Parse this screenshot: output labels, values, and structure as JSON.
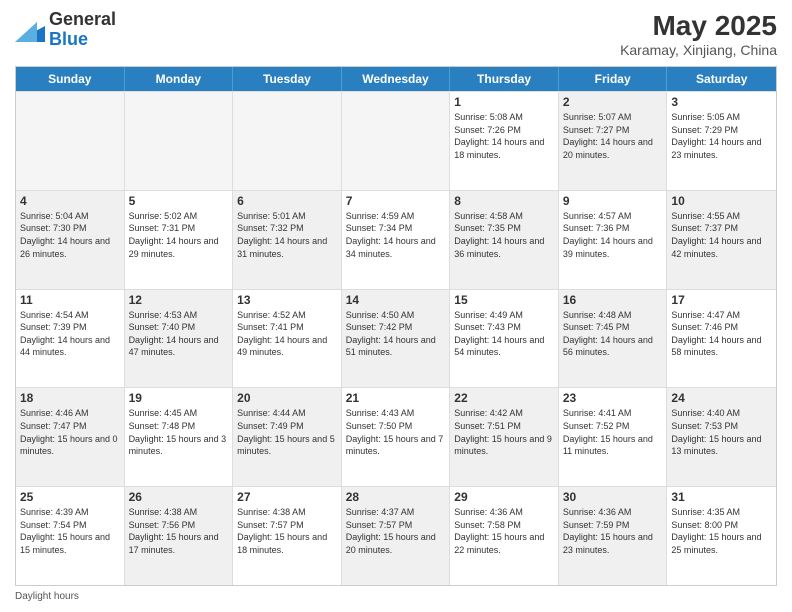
{
  "header": {
    "logo_general": "General",
    "logo_blue": "Blue",
    "main_title": "May 2025",
    "subtitle": "Karamay, Xinjiang, China"
  },
  "days_of_week": [
    "Sunday",
    "Monday",
    "Tuesday",
    "Wednesday",
    "Thursday",
    "Friday",
    "Saturday"
  ],
  "footer_text": "Daylight hours",
  "rows": [
    [
      {
        "day": "",
        "text": "",
        "empty": true
      },
      {
        "day": "",
        "text": "",
        "empty": true
      },
      {
        "day": "",
        "text": "",
        "empty": true
      },
      {
        "day": "",
        "text": "",
        "empty": true
      },
      {
        "day": "1",
        "text": "Sunrise: 5:08 AM\nSunset: 7:26 PM\nDaylight: 14 hours\nand 18 minutes.",
        "empty": false
      },
      {
        "day": "2",
        "text": "Sunrise: 5:07 AM\nSunset: 7:27 PM\nDaylight: 14 hours\nand 20 minutes.",
        "empty": false,
        "alt": true
      },
      {
        "day": "3",
        "text": "Sunrise: 5:05 AM\nSunset: 7:29 PM\nDaylight: 14 hours\nand 23 minutes.",
        "empty": false
      }
    ],
    [
      {
        "day": "4",
        "text": "Sunrise: 5:04 AM\nSunset: 7:30 PM\nDaylight: 14 hours\nand 26 minutes.",
        "empty": false,
        "alt": true
      },
      {
        "day": "5",
        "text": "Sunrise: 5:02 AM\nSunset: 7:31 PM\nDaylight: 14 hours\nand 29 minutes.",
        "empty": false
      },
      {
        "day": "6",
        "text": "Sunrise: 5:01 AM\nSunset: 7:32 PM\nDaylight: 14 hours\nand 31 minutes.",
        "empty": false,
        "alt": true
      },
      {
        "day": "7",
        "text": "Sunrise: 4:59 AM\nSunset: 7:34 PM\nDaylight: 14 hours\nand 34 minutes.",
        "empty": false
      },
      {
        "day": "8",
        "text": "Sunrise: 4:58 AM\nSunset: 7:35 PM\nDaylight: 14 hours\nand 36 minutes.",
        "empty": false,
        "alt": true
      },
      {
        "day": "9",
        "text": "Sunrise: 4:57 AM\nSunset: 7:36 PM\nDaylight: 14 hours\nand 39 minutes.",
        "empty": false
      },
      {
        "day": "10",
        "text": "Sunrise: 4:55 AM\nSunset: 7:37 PM\nDaylight: 14 hours\nand 42 minutes.",
        "empty": false,
        "alt": true
      }
    ],
    [
      {
        "day": "11",
        "text": "Sunrise: 4:54 AM\nSunset: 7:39 PM\nDaylight: 14 hours\nand 44 minutes.",
        "empty": false
      },
      {
        "day": "12",
        "text": "Sunrise: 4:53 AM\nSunset: 7:40 PM\nDaylight: 14 hours\nand 47 minutes.",
        "empty": false,
        "alt": true
      },
      {
        "day": "13",
        "text": "Sunrise: 4:52 AM\nSunset: 7:41 PM\nDaylight: 14 hours\nand 49 minutes.",
        "empty": false
      },
      {
        "day": "14",
        "text": "Sunrise: 4:50 AM\nSunset: 7:42 PM\nDaylight: 14 hours\nand 51 minutes.",
        "empty": false,
        "alt": true
      },
      {
        "day": "15",
        "text": "Sunrise: 4:49 AM\nSunset: 7:43 PM\nDaylight: 14 hours\nand 54 minutes.",
        "empty": false
      },
      {
        "day": "16",
        "text": "Sunrise: 4:48 AM\nSunset: 7:45 PM\nDaylight: 14 hours\nand 56 minutes.",
        "empty": false,
        "alt": true
      },
      {
        "day": "17",
        "text": "Sunrise: 4:47 AM\nSunset: 7:46 PM\nDaylight: 14 hours\nand 58 minutes.",
        "empty": false
      }
    ],
    [
      {
        "day": "18",
        "text": "Sunrise: 4:46 AM\nSunset: 7:47 PM\nDaylight: 15 hours\nand 0 minutes.",
        "empty": false,
        "alt": true
      },
      {
        "day": "19",
        "text": "Sunrise: 4:45 AM\nSunset: 7:48 PM\nDaylight: 15 hours\nand 3 minutes.",
        "empty": false
      },
      {
        "day": "20",
        "text": "Sunrise: 4:44 AM\nSunset: 7:49 PM\nDaylight: 15 hours\nand 5 minutes.",
        "empty": false,
        "alt": true
      },
      {
        "day": "21",
        "text": "Sunrise: 4:43 AM\nSunset: 7:50 PM\nDaylight: 15 hours\nand 7 minutes.",
        "empty": false
      },
      {
        "day": "22",
        "text": "Sunrise: 4:42 AM\nSunset: 7:51 PM\nDaylight: 15 hours\nand 9 minutes.",
        "empty": false,
        "alt": true
      },
      {
        "day": "23",
        "text": "Sunrise: 4:41 AM\nSunset: 7:52 PM\nDaylight: 15 hours\nand 11 minutes.",
        "empty": false
      },
      {
        "day": "24",
        "text": "Sunrise: 4:40 AM\nSunset: 7:53 PM\nDaylight: 15 hours\nand 13 minutes.",
        "empty": false,
        "alt": true
      }
    ],
    [
      {
        "day": "25",
        "text": "Sunrise: 4:39 AM\nSunset: 7:54 PM\nDaylight: 15 hours\nand 15 minutes.",
        "empty": false
      },
      {
        "day": "26",
        "text": "Sunrise: 4:38 AM\nSunset: 7:56 PM\nDaylight: 15 hours\nand 17 minutes.",
        "empty": false,
        "alt": true
      },
      {
        "day": "27",
        "text": "Sunrise: 4:38 AM\nSunset: 7:57 PM\nDaylight: 15 hours\nand 18 minutes.",
        "empty": false
      },
      {
        "day": "28",
        "text": "Sunrise: 4:37 AM\nSunset: 7:57 PM\nDaylight: 15 hours\nand 20 minutes.",
        "empty": false,
        "alt": true
      },
      {
        "day": "29",
        "text": "Sunrise: 4:36 AM\nSunset: 7:58 PM\nDaylight: 15 hours\nand 22 minutes.",
        "empty": false
      },
      {
        "day": "30",
        "text": "Sunrise: 4:36 AM\nSunset: 7:59 PM\nDaylight: 15 hours\nand 23 minutes.",
        "empty": false,
        "alt": true
      },
      {
        "day": "31",
        "text": "Sunrise: 4:35 AM\nSunset: 8:00 PM\nDaylight: 15 hours\nand 25 minutes.",
        "empty": false
      }
    ]
  ]
}
